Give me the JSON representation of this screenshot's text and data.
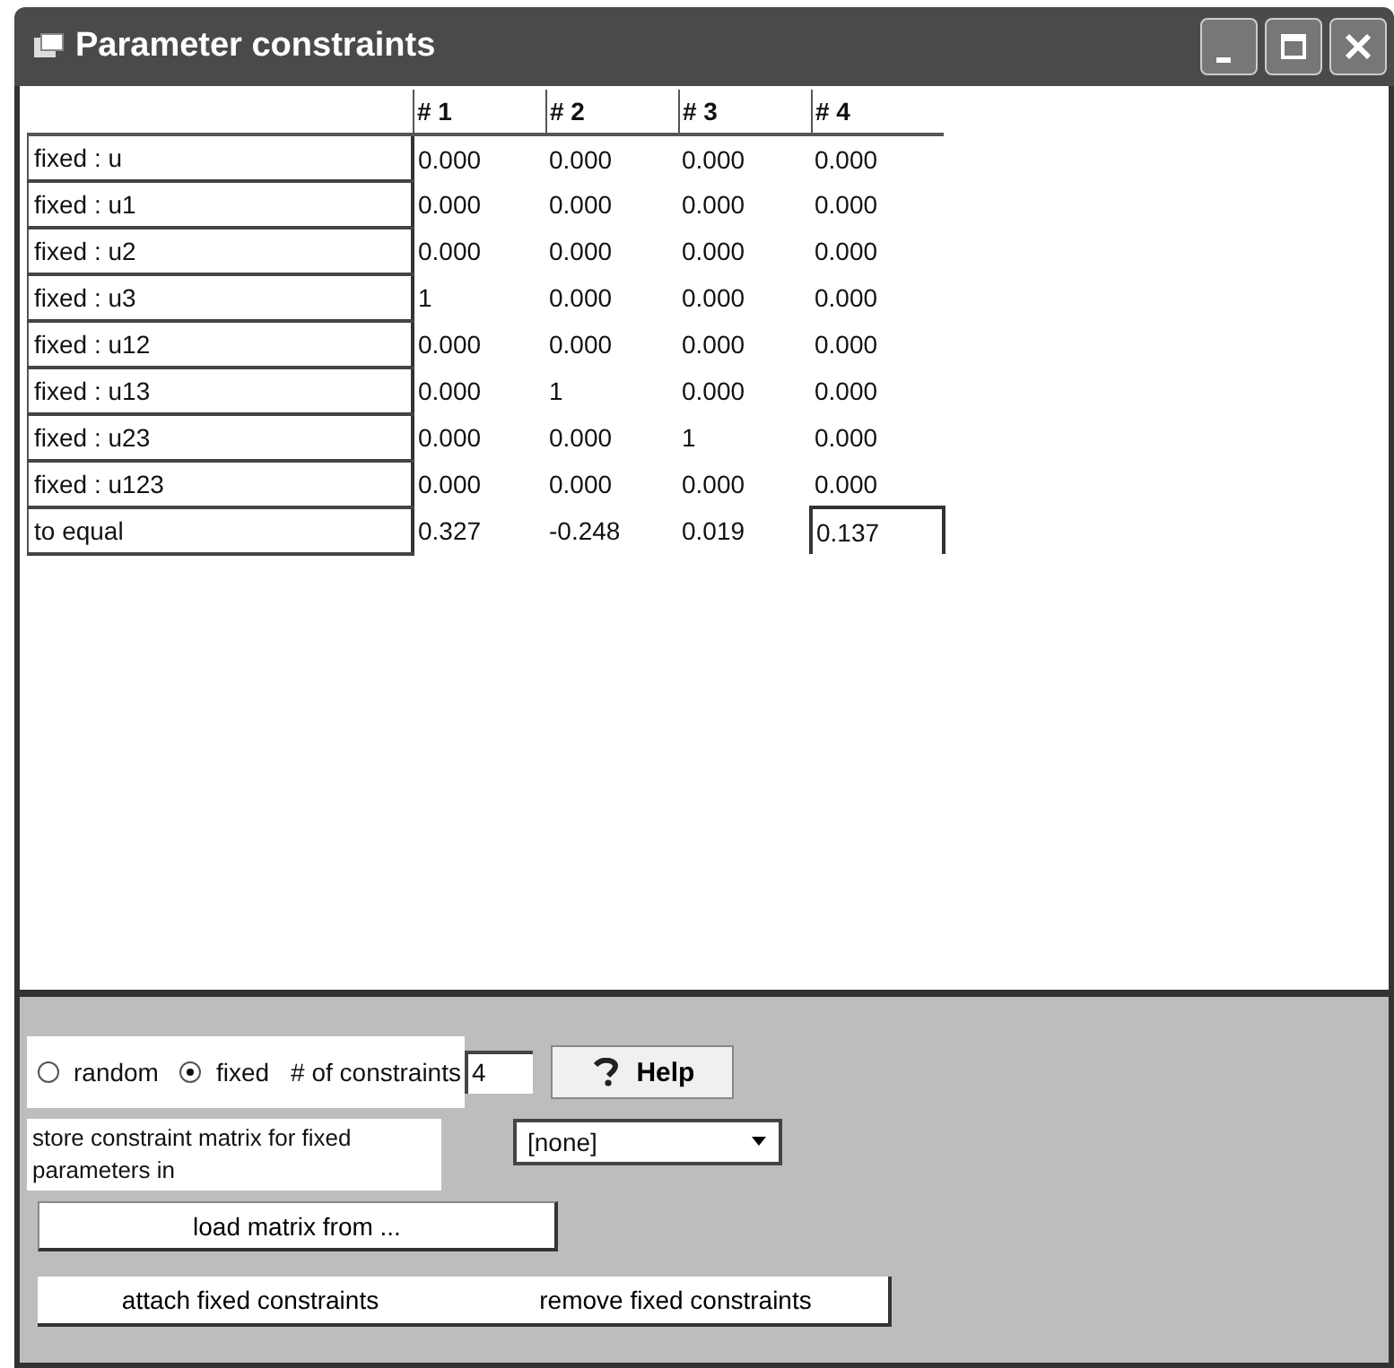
{
  "window": {
    "title": "Parameter constraints"
  },
  "table": {
    "columns": [
      "# 1",
      "# 2",
      "# 3",
      "# 4"
    ],
    "rows": [
      {
        "label": "fixed : u",
        "cells": [
          {
            "text": "0.000",
            "focused": false
          },
          {
            "text": "0.000",
            "focused": false
          },
          {
            "text": "0.000",
            "focused": false
          },
          {
            "text": "0.000",
            "focused": false
          }
        ]
      },
      {
        "label": "fixed : u1",
        "cells": [
          {
            "text": "0.000",
            "focused": false
          },
          {
            "text": "0.000",
            "focused": false
          },
          {
            "text": "0.000",
            "focused": false
          },
          {
            "text": "0.000",
            "focused": false
          }
        ]
      },
      {
        "label": "fixed : u2",
        "cells": [
          {
            "text": "0.000",
            "focused": false
          },
          {
            "text": "0.000",
            "focused": false
          },
          {
            "text": "0.000",
            "focused": false
          },
          {
            "text": "0.000",
            "focused": false
          }
        ]
      },
      {
        "label": "fixed : u3",
        "cells": [
          {
            "text": "1",
            "focused": false
          },
          {
            "text": "0.000",
            "focused": false
          },
          {
            "text": "0.000",
            "focused": false
          },
          {
            "text": "0.000",
            "focused": false
          }
        ]
      },
      {
        "label": "fixed : u12",
        "cells": [
          {
            "text": "0.000",
            "focused": false
          },
          {
            "text": "0.000",
            "focused": false
          },
          {
            "text": "0.000",
            "focused": false
          },
          {
            "text": "0.000",
            "focused": false
          }
        ]
      },
      {
        "label": "fixed : u13",
        "cells": [
          {
            "text": "0.000",
            "focused": false
          },
          {
            "text": "1",
            "focused": false
          },
          {
            "text": "0.000",
            "focused": false
          },
          {
            "text": "0.000",
            "focused": false
          }
        ]
      },
      {
        "label": "fixed : u23",
        "cells": [
          {
            "text": "0.000",
            "focused": false
          },
          {
            "text": "0.000",
            "focused": false
          },
          {
            "text": "1",
            "focused": false
          },
          {
            "text": "0.000",
            "focused": false
          }
        ]
      },
      {
        "label": "fixed : u123",
        "cells": [
          {
            "text": "0.000",
            "focused": false
          },
          {
            "text": "0.000",
            "focused": false
          },
          {
            "text": "0.000",
            "focused": false
          },
          {
            "text": "0.000",
            "focused": false
          }
        ]
      },
      {
        "label": "to equal",
        "cells": [
          {
            "text": "0.327",
            "focused": false
          },
          {
            "text": "-0.248",
            "focused": false
          },
          {
            "text": "0.019",
            "focused": false
          },
          {
            "text": "0.137",
            "focused": true
          }
        ]
      }
    ]
  },
  "mode": [
    {
      "label": "random",
      "selected": false
    },
    {
      "label": "fixed",
      "selected": true
    }
  ],
  "constraints_label": "# of constraints",
  "constraints_value": "4",
  "help_button": "Help",
  "store_label": "store constraint matrix for fixed parameters in",
  "store_select": "[none]",
  "load_button": "load matrix from ...",
  "buttons": [
    "attach fixed constraints",
    "remove fixed constraints"
  ]
}
